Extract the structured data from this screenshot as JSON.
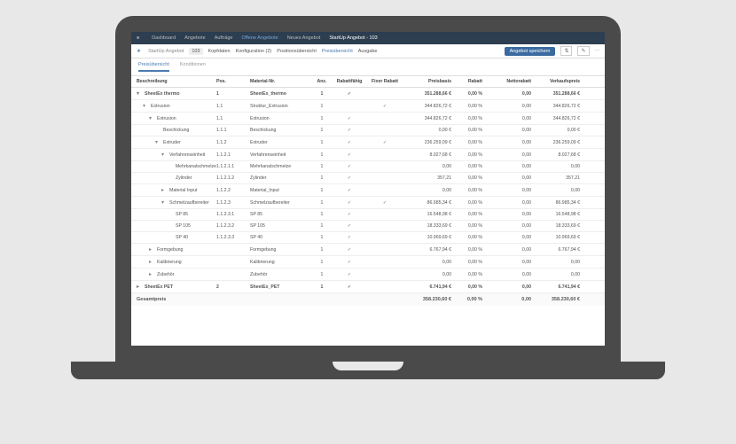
{
  "topnav": {
    "items": [
      "Dashboard",
      "Angebote",
      "Aufträge",
      "Offene Angebote",
      "Neues Angebot",
      "StartUp Angebot - 103"
    ]
  },
  "secondnav": {
    "star": "★",
    "title": "StartUp Angebot",
    "num": "103",
    "items": [
      "Kopfdaten",
      "Konfiguration (2)",
      "Positionsübersicht",
      "Preisübersicht",
      "Ausgabe"
    ],
    "activeIndex": 3,
    "save": "Angebot speichern"
  },
  "tabs": {
    "items": [
      "Preisübersicht",
      "Konditionen"
    ],
    "activeIndex": 0
  },
  "headers": {
    "desc": "Beschreibung",
    "pos": "Pos.",
    "mat": "Material-Nr.",
    "anz": "Anz.",
    "rab": "Rabattfähig",
    "fix": "Fixer Rabatt",
    "pb": "Preisbasis",
    "r1": "Rabatt",
    "r2": "Nettorabatt",
    "vp": "Verkaufspreis"
  },
  "rows": [
    {
      "i": 0,
      "bold": true,
      "ic": "▾",
      "d": "SheetEx thermo",
      "p": "1",
      "m": "SheetEx_thermo",
      "a": "1",
      "rf": "✓",
      "fx": "",
      "pb": "351.288,66 €",
      "r1": "0,00 %",
      "r2": "0,00",
      "vp": "351.288,66 €"
    },
    {
      "i": 1,
      "ic": "▾",
      "d": "Extrusion",
      "p": "1.1",
      "m": "Struktur_Extrusion",
      "a": "1",
      "rf": "",
      "fx": "✓",
      "pb": "344.826,72 €",
      "r1": "0,00 %",
      "r2": "0,00",
      "vp": "344.826,72 €"
    },
    {
      "i": 2,
      "ic": "▾",
      "d": "Extrusion",
      "p": "1.1",
      "m": "Extrusion",
      "a": "1",
      "rf": "✓",
      "fx": "",
      "pb": "344.826,72 €",
      "r1": "0,00 %",
      "r2": "0,00",
      "vp": "344.826,72 €"
    },
    {
      "i": 3,
      "ic": "",
      "d": "Beschickung",
      "p": "1.1.1",
      "m": "Beschickung",
      "a": "1",
      "rf": "✓",
      "fx": "",
      "pb": "0,00 €",
      "r1": "0,00 %",
      "r2": "0,00",
      "vp": "0,00 €"
    },
    {
      "i": 3,
      "ic": "▾",
      "d": "Extruder",
      "p": "1.1.2",
      "m": "Extruder",
      "a": "1",
      "rf": "✓",
      "fx": "✓",
      "pb": "236.259,09 €",
      "r1": "0,00 %",
      "r2": "0,00",
      "vp": "236.259,09 €"
    },
    {
      "i": 4,
      "ic": "▾",
      "d": "Verfahrenseinheit",
      "p": "1.1.2.1",
      "m": "Verfahrenseinheit",
      "a": "1",
      "rf": "✓",
      "fx": "",
      "pb": "8.027,68 €",
      "r1": "0,00 %",
      "r2": "0,00",
      "vp": "8.027,68 €"
    },
    {
      "i": 5,
      "ic": "",
      "d": "Mehrkanalschmelze",
      "p": "1.1.2.1.1",
      "m": "Mehrkanalschmelze",
      "a": "1",
      "rf": "✓",
      "fx": "",
      "pb": "0,00",
      "r1": "0,00 %",
      "r2": "0,00",
      "vp": "0,00"
    },
    {
      "i": 5,
      "ic": "",
      "d": "Zylinder",
      "p": "1.1.2.1.2",
      "m": "Zylinder",
      "a": "1",
      "rf": "✓",
      "fx": "",
      "pb": "357,21",
      "r1": "0,00 %",
      "r2": "0,00",
      "vp": "357,21"
    },
    {
      "i": 4,
      "ic": "▸",
      "d": "Material Input",
      "p": "1.1.2.2",
      "m": "Material_Input",
      "a": "1",
      "rf": "✓",
      "fx": "",
      "pb": "0,00",
      "r1": "0,00 %",
      "r2": "0,00",
      "vp": "0,00"
    },
    {
      "i": 4,
      "ic": "▾",
      "d": "Schmelzaufbereiter",
      "p": "1.1.2.3",
      "m": "Schmelzaufbereiter",
      "a": "1",
      "rf": "✓",
      "fx": "✓",
      "pb": "86.985,34 €",
      "r1": "0,00 %",
      "r2": "0,00",
      "vp": "86.985,34 €"
    },
    {
      "i": 5,
      "ic": "",
      "d": "SP 85",
      "p": "1.1.2.3.1",
      "m": "SP 85",
      "a": "1",
      "rf": "✓",
      "fx": "",
      "pb": "16.548,98 €",
      "r1": "0,00 %",
      "r2": "0,00",
      "vp": "16.548,98 €"
    },
    {
      "i": 5,
      "ic": "",
      "d": "SP 105",
      "p": "1.1.2.3.2",
      "m": "SP 105",
      "a": "1",
      "rf": "✓",
      "fx": "",
      "pb": "18.333,69 €",
      "r1": "0,00 %",
      "r2": "0,00",
      "vp": "18.333,69 €"
    },
    {
      "i": 5,
      "ic": "",
      "d": "SP 40",
      "p": "1.1.2.3.3",
      "m": "SP 40",
      "a": "1",
      "rf": "✓",
      "fx": "",
      "pb": "10.969,69 €",
      "r1": "0,00 %",
      "r2": "0,00",
      "vp": "10.969,69 €"
    },
    {
      "i": 2,
      "ic": "▸",
      "d": "Formgebung",
      "p": "",
      "m": "Formgebung",
      "a": "1",
      "rf": "✓",
      "fx": "",
      "pb": "6.767,94 €",
      "r1": "0,00 %",
      "r2": "0,00",
      "vp": "6.767,94 €"
    },
    {
      "i": 2,
      "ic": "▸",
      "d": "Kalibrierung",
      "p": "",
      "m": "Kalibrierung",
      "a": "1",
      "rf": "✓",
      "fx": "",
      "pb": "0,00",
      "r1": "0,00 %",
      "r2": "0,00",
      "vp": "0,00"
    },
    {
      "i": 2,
      "ic": "▸",
      "d": "Zubehör",
      "p": "",
      "m": "Zubehör",
      "a": "1",
      "rf": "✓",
      "fx": "",
      "pb": "0,00",
      "r1": "0,00 %",
      "r2": "0,00",
      "vp": "0,00"
    },
    {
      "i": 0,
      "bold": true,
      "ic": "▸",
      "d": "SheetEx PET",
      "p": "2",
      "m": "SheetEx_PET",
      "a": "1",
      "rf": "✓",
      "fx": "",
      "pb": "6.741,94 €",
      "r1": "0,00 %",
      "r2": "0,00",
      "vp": "6.741,94 €"
    }
  ],
  "total": {
    "label": "Gesamtpreis",
    "pb": "358.230,60 €",
    "r1": "0,00 %",
    "r2": "0,00",
    "vp": "358.230,60 €"
  }
}
